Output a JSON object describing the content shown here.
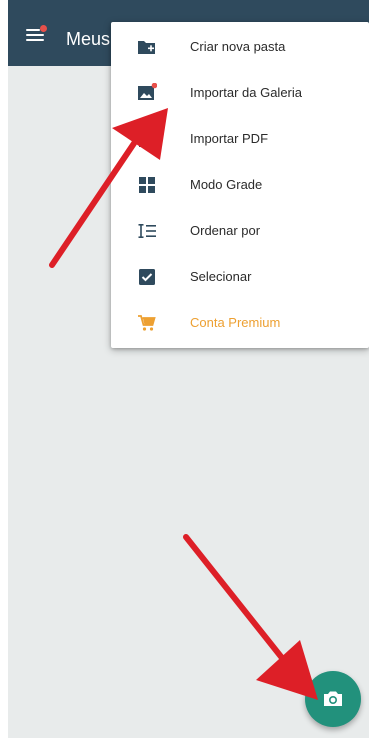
{
  "appbar": {
    "title": "Meus"
  },
  "menu": {
    "items": [
      {
        "label": "Criar nova pasta",
        "icon": "folder-plus-icon"
      },
      {
        "label": "Importar da Galeria",
        "icon": "image-icon"
      },
      {
        "label": "Importar PDF",
        "icon": "pdf-icon"
      },
      {
        "label": "Modo Grade",
        "icon": "grid-icon"
      },
      {
        "label": "Ordenar por",
        "icon": "sort-icon"
      },
      {
        "label": "Selecionar",
        "icon": "checkbox-icon"
      },
      {
        "label": "Conta Premium",
        "icon": "cart-icon"
      }
    ]
  },
  "fab": {
    "icon": "camera-icon"
  },
  "colors": {
    "appbar": "#2f4a5d",
    "background": "#e8ebeb",
    "icon": "#2f4a5d",
    "premium": "#eda032",
    "fab": "#22917c",
    "badge": "#e7504a",
    "arrow": "#dd1f27"
  }
}
